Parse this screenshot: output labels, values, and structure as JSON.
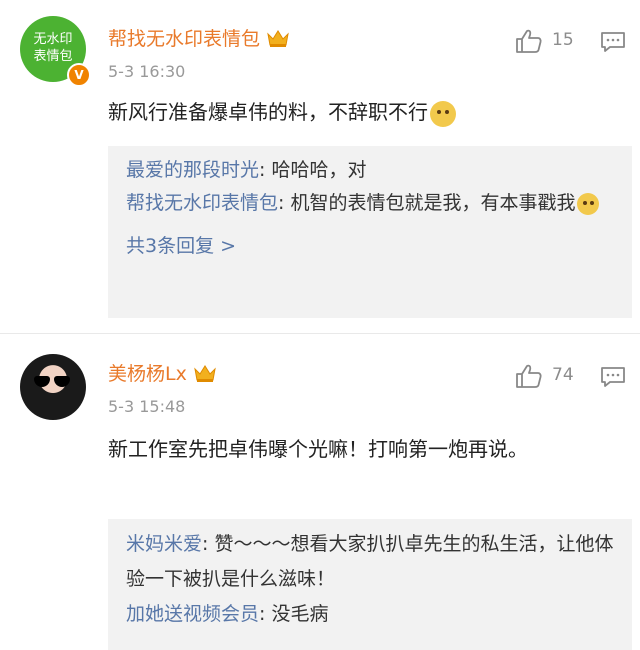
{
  "comments": [
    {
      "avatar_text": "无水印\n表情包",
      "verified_badge": "V",
      "username": "帮找无水印表情包",
      "time": "5-3 16:30",
      "likes": "15",
      "text": "新风行准备爆卓伟的料，不辞职不行",
      "replies": [
        {
          "user": "最爱的那段时光",
          "sep": ": ",
          "text": "哈哈哈，对"
        },
        {
          "user": "帮找无水印表情包",
          "sep": ": ",
          "text": "机智的表情包就是我，有本事戳我"
        }
      ],
      "more_replies": "共3条回复 >"
    },
    {
      "username": "美杨杨Lx",
      "time": "5-3 15:48",
      "likes": "74",
      "text": "新工作室先把卓伟曝个光嘛！打响第一炮再说。",
      "replies": [
        {
          "user": "米妈米爱",
          "sep": ": ",
          "text": "赞～～～想看大家扒扒卓先生的私生活，让他体验一下被扒是什么滋味！"
        },
        {
          "user": "加她送视频会员",
          "sep": ": ",
          "text": "没毛病"
        }
      ]
    }
  ],
  "colors": {
    "username": "#e97a2b",
    "reply_username": "#5877a8",
    "avatar_green": "#4cb232",
    "reply_bg": "#f2f2f2"
  },
  "icons": [
    "crown-icon",
    "thumbs-up-icon",
    "reply-icon",
    "doge-emoji",
    "verified-badge-icon"
  ]
}
